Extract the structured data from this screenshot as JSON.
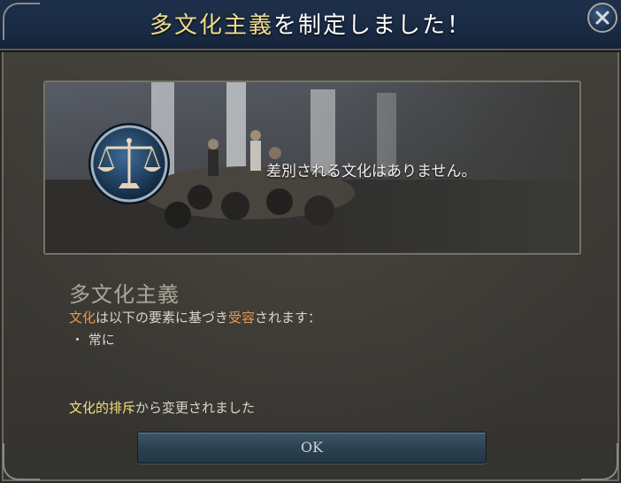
{
  "title": {
    "highlight": "多文化主義",
    "rest": "を制定しました！"
  },
  "close_icon": "close-icon",
  "picture": {
    "caption": "差別される文化はありません。",
    "emblem_icon": "scales-icon"
  },
  "policy": {
    "name": "多文化主義",
    "desc_culture": "文化",
    "desc_mid": "は以下の要素に基づき",
    "desc_accept": "受容",
    "desc_end": "されます：",
    "bullet": "・ 常に"
  },
  "change": {
    "from": "文化的排斥",
    "suffix": "から変更されました"
  },
  "ok_button": "OK",
  "colors": {
    "title_bar": "#1a2b45",
    "highlight_gold": "#f0dc8c",
    "accent_orange": "#e49a55",
    "accent_yellow": "#f2e07e",
    "button": "#2c4252"
  }
}
